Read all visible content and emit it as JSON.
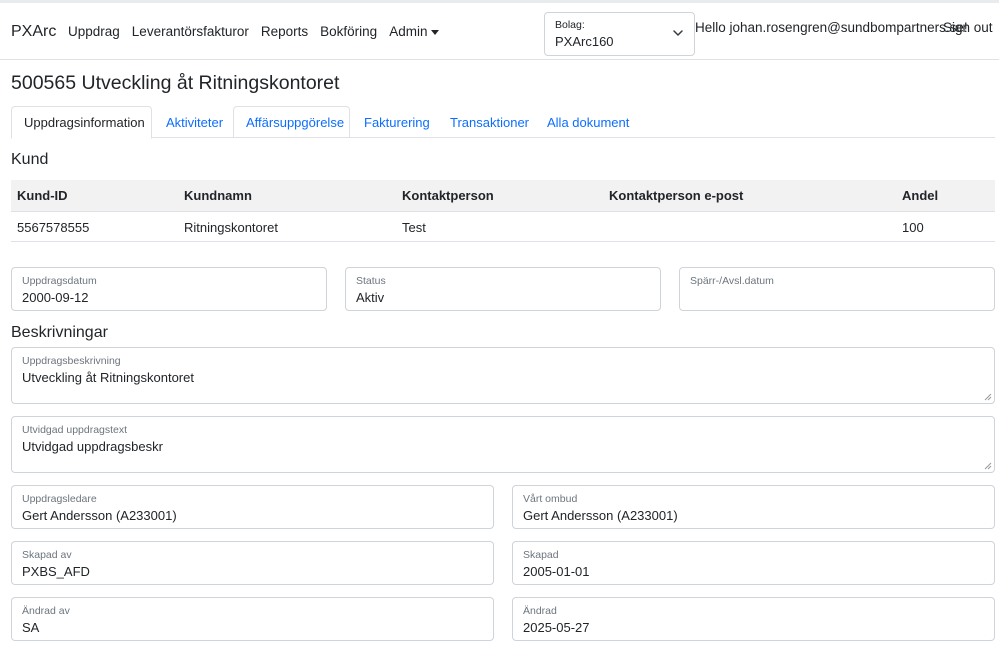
{
  "nav": {
    "brand": "PXArc",
    "links": [
      "Uppdrag",
      "Leverantörsfakturor",
      "Reports",
      "Bokföring"
    ],
    "admin": "Admin",
    "bolag_label": "Bolag:",
    "bolag_value": "PXArc160",
    "hello": "Hello johan.rosengren@sundbompartners.se!",
    "signout": "Sign out"
  },
  "page": {
    "title": "500565 Utveckling åt Ritningskontoret"
  },
  "tabs": [
    "Uppdragsinformation",
    "Aktiviteter",
    "Affärsuppgörelse",
    "Fakturering",
    "Transaktioner",
    "Alla dokument"
  ],
  "kund": {
    "title": "Kund",
    "headers": [
      "Kund-ID",
      "Kundnamn",
      "Kontaktperson",
      "Kontaktperson e-post",
      "Andel"
    ],
    "row": [
      "5567578555",
      "Ritningskontoret",
      "Test",
      "",
      "100"
    ]
  },
  "fields": {
    "uppdragsdatum": {
      "label": "Uppdragsdatum",
      "value": "2000-09-12"
    },
    "status": {
      "label": "Status",
      "value": "Aktiv"
    },
    "sparr": {
      "label": "Spärr-/Avsl.datum",
      "value": ""
    }
  },
  "beskrivningar": {
    "title": "Beskrivningar",
    "uppdragsbeskrivning": {
      "label": "Uppdragsbeskrivning",
      "value": "Utveckling åt Ritningskontoret"
    },
    "utvidgad": {
      "label": "Utvidgad uppdragstext",
      "value": "Utvidgad uppdragsbeskr"
    },
    "uppdragsledare": {
      "label": "Uppdragsledare",
      "value": "Gert Andersson (A233001)"
    },
    "ombud": {
      "label": "Vårt ombud",
      "value": "Gert Andersson (A233001)"
    },
    "skapad_av": {
      "label": "Skapad av",
      "value": "PXBS_AFD"
    },
    "skapad": {
      "label": "Skapad",
      "value": "2005-01-01"
    },
    "andrad_av": {
      "label": "Ändrad av",
      "value": "SA"
    },
    "andrad": {
      "label": "Ändrad",
      "value": "2025-05-27"
    }
  }
}
